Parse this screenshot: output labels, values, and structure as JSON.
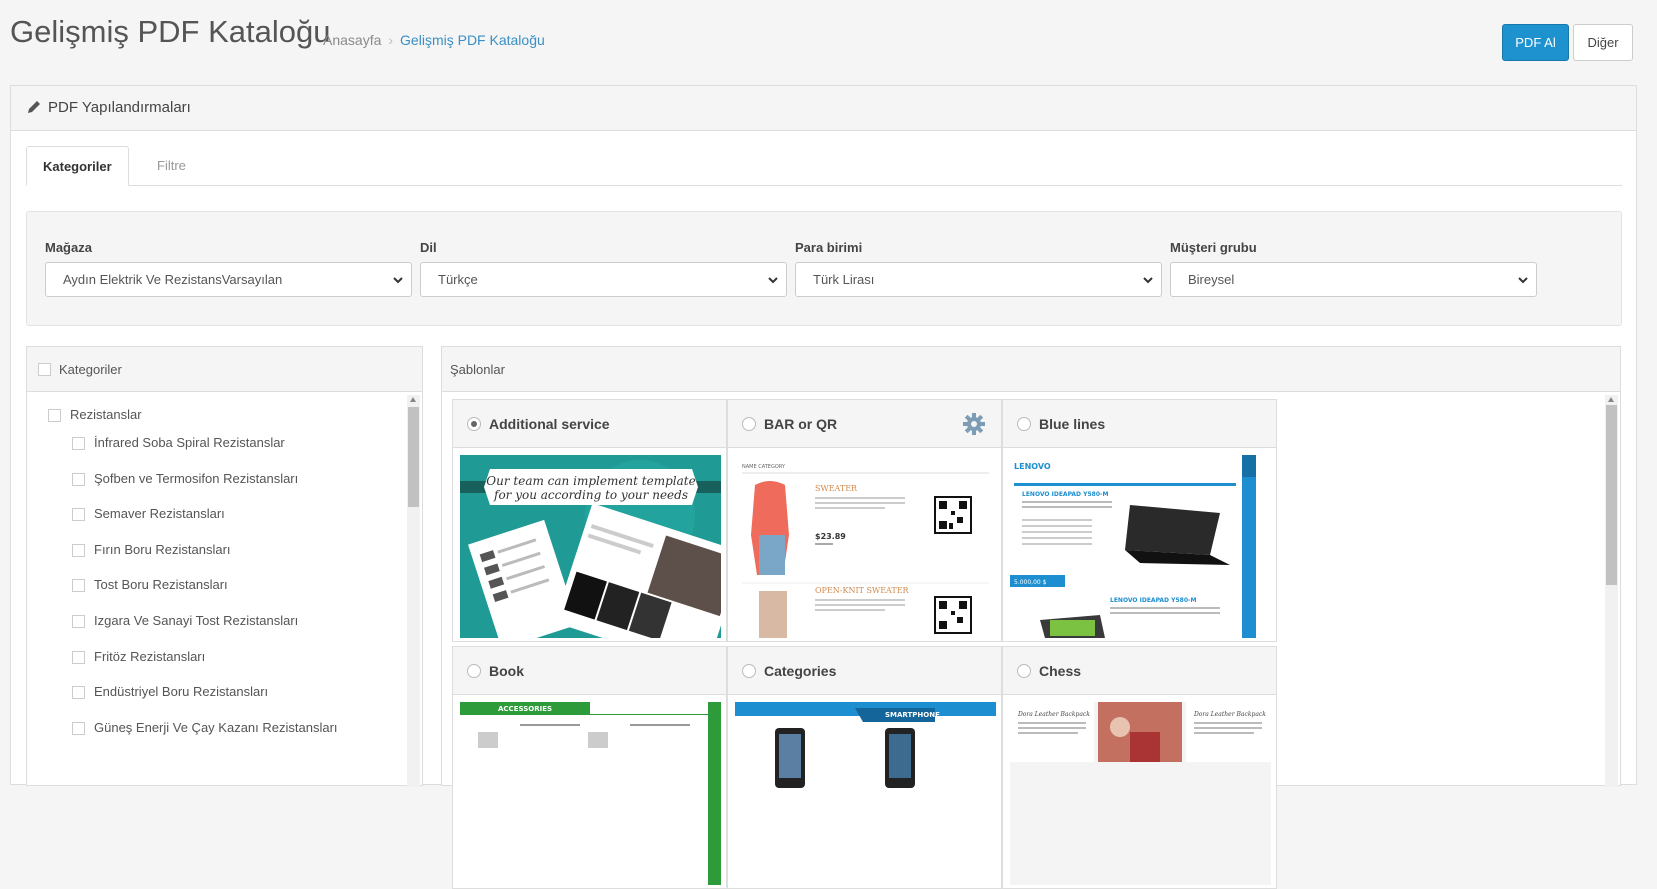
{
  "header": {
    "title": "Gelişmiş PDF Kataloğu",
    "breadcrumb": [
      "Anasayfa",
      "Gelişmiş PDF Kataloğu"
    ],
    "pdf_button": "PDF Al",
    "other_button": "Diğer"
  },
  "panel": {
    "title": "PDF Yapılandırmaları"
  },
  "tabs": [
    {
      "label": "Kategoriler",
      "active": true
    },
    {
      "label": "Filtre",
      "active": false
    }
  ],
  "filters": {
    "store": {
      "label": "Mağaza",
      "value": "Aydın Elektrik Ve RezistansVarsayılan"
    },
    "language": {
      "label": "Dil",
      "value": "Türkçe"
    },
    "currency": {
      "label": "Para birimi",
      "value": "Türk Lirası"
    },
    "customer_group": {
      "label": "Müşteri grubu",
      "value": "Bireysel"
    }
  },
  "categories": {
    "heading": "Kategoriler",
    "items": [
      {
        "label": "Rezistanslar",
        "level": 0
      },
      {
        "label": "İnfrared Soba Spiral Rezistanslar",
        "level": 1
      },
      {
        "label": "Şofben ve Termosifon Rezistansları",
        "level": 1
      },
      {
        "label": "Semaver Rezistansları",
        "level": 1
      },
      {
        "label": "Fırın Boru Rezistansları",
        "level": 1
      },
      {
        "label": "Tost Boru Rezistansları",
        "level": 1
      },
      {
        "label": "Izgara Ve Sanayi Tost Rezistansları",
        "level": 1
      },
      {
        "label": "Fritöz Rezistansları",
        "level": 1
      },
      {
        "label": "Endüstriyel Boru Rezistansları",
        "level": 1
      },
      {
        "label": "Güneş Enerji Ve Çay Kazanı Rezistansları",
        "level": 1
      }
    ]
  },
  "templates": {
    "heading": "Şablonlar",
    "items": [
      {
        "name": "Additional service",
        "selected": true,
        "thumb_text": "Our team can implement template for you according to your needs"
      },
      {
        "name": "BAR or QR",
        "selected": false,
        "settings": true,
        "thumb": {
          "category": "NAME CATEGORY",
          "product1": "SWEATER",
          "price": "$23.89",
          "product2": "OPEN-KNIT SWEATER"
        }
      },
      {
        "name": "Blue lines",
        "selected": false,
        "thumb": {
          "brand": "LENOVO",
          "product": "LENOVO IDEAPAD Y580-M",
          "price": "5.000,00 $"
        }
      },
      {
        "name": "Book",
        "selected": false,
        "thumb": {
          "section": "ACCESSORIES"
        }
      },
      {
        "name": "Categories",
        "selected": false,
        "thumb": {
          "section": "SMARTPHONE"
        }
      },
      {
        "name": "Chess",
        "selected": false,
        "thumb": {
          "product": "Dora Leather Backpack"
        }
      }
    ]
  },
  "colors": {
    "primary": "#1e91cf",
    "link": "#3a8fc4"
  }
}
